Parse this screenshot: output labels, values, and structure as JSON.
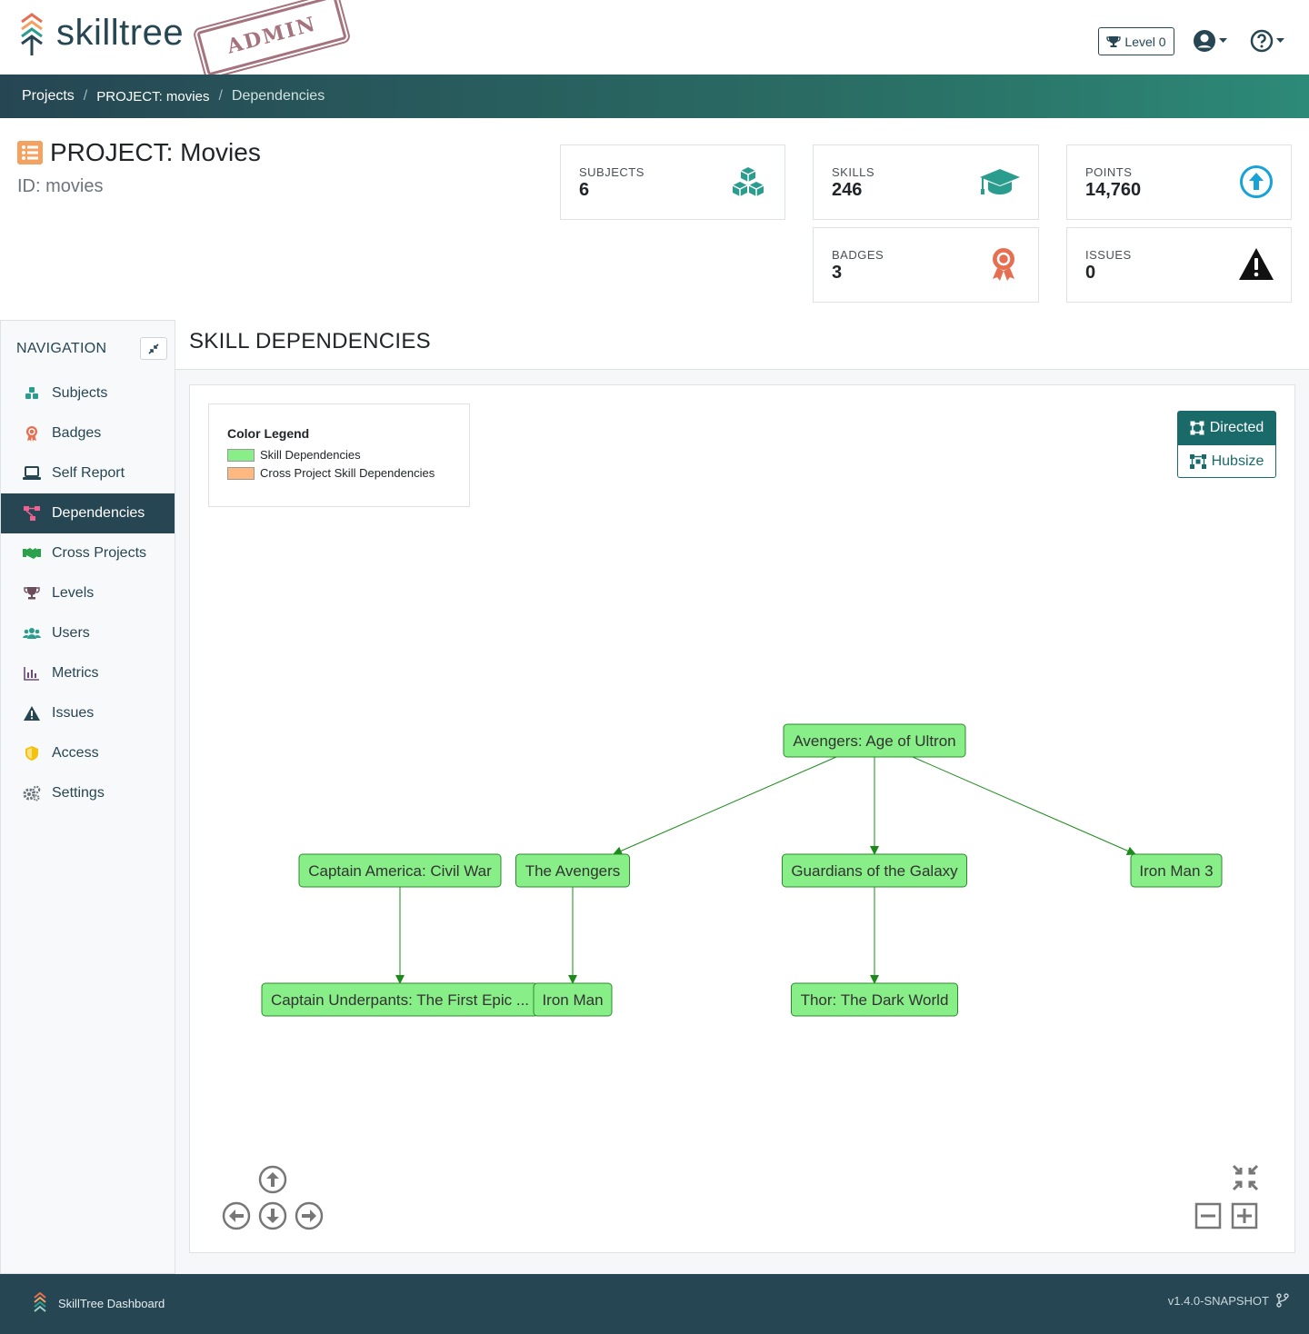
{
  "header": {
    "brand": "skilltree",
    "stamp": "ADMIN",
    "level_label": "Level 0",
    "icons": [
      "trophy-icon",
      "user-circle-icon",
      "help-circle-icon"
    ]
  },
  "breadcrumb": {
    "items": [
      "Projects",
      "PROJECT: movies",
      "Dependencies"
    ]
  },
  "project": {
    "title": "PROJECT: Movies",
    "id_text": "ID: movies"
  },
  "stats": {
    "subjects": {
      "label": "SUBJECTS",
      "value": "6"
    },
    "skills": {
      "label": "SKILLS",
      "value": "246"
    },
    "points": {
      "label": "POINTS",
      "value": "14,760"
    },
    "badges": {
      "label": "BADGES",
      "value": "3"
    },
    "issues": {
      "label": "ISSUES",
      "value": "0"
    }
  },
  "sidebar": {
    "title": "NAVIGATION",
    "items": [
      {
        "label": "Subjects",
        "icon": "cubes-icon"
      },
      {
        "label": "Badges",
        "icon": "award-icon"
      },
      {
        "label": "Self Report",
        "icon": "laptop-icon"
      },
      {
        "label": "Dependencies",
        "icon": "project-diagram-icon",
        "active": true
      },
      {
        "label": "Cross Projects",
        "icon": "handshake-icon"
      },
      {
        "label": "Levels",
        "icon": "trophy-icon"
      },
      {
        "label": "Users",
        "icon": "users-icon"
      },
      {
        "label": "Metrics",
        "icon": "chart-bar-icon"
      },
      {
        "label": "Issues",
        "icon": "warning-icon"
      },
      {
        "label": "Access",
        "icon": "shield-icon"
      },
      {
        "label": "Settings",
        "icon": "cogs-icon"
      }
    ]
  },
  "main": {
    "title": "SKILL DEPENDENCIES",
    "legend": {
      "title": "Color Legend",
      "items": [
        {
          "label": "Skill Dependencies",
          "color": "#88ee88"
        },
        {
          "label": "Cross Project Skill Dependencies",
          "color": "#ffb87f"
        }
      ]
    },
    "layout_buttons": {
      "directed": "Directed",
      "hubsize": "Hubsize"
    },
    "graph": {
      "nodes": [
        {
          "id": "ultron",
          "label": "Avengers: Age of Ultron"
        },
        {
          "id": "civilwar",
          "label": "Captain America: Civil War"
        },
        {
          "id": "avengers",
          "label": "The Avengers"
        },
        {
          "id": "guardians",
          "label": "Guardians of the Galaxy"
        },
        {
          "id": "ironman3",
          "label": "Iron Man 3"
        },
        {
          "id": "underpants",
          "label": "Captain Underpants: The First Epic ..."
        },
        {
          "id": "ironman",
          "label": "Iron Man"
        },
        {
          "id": "thor",
          "label": "Thor: The Dark World"
        }
      ],
      "edges": [
        [
          "ultron",
          "avengers"
        ],
        [
          "ultron",
          "guardians"
        ],
        [
          "ultron",
          "ironman3"
        ],
        [
          "civilwar",
          "underpants"
        ],
        [
          "avengers",
          "ironman"
        ],
        [
          "guardians",
          "thor"
        ]
      ],
      "node_color": "#88ee88",
      "edge_color": "#1a8a1a"
    }
  },
  "footer": {
    "app_name": "SkillTree Dashboard",
    "version": "v1.4.0-SNAPSHOT"
  }
}
